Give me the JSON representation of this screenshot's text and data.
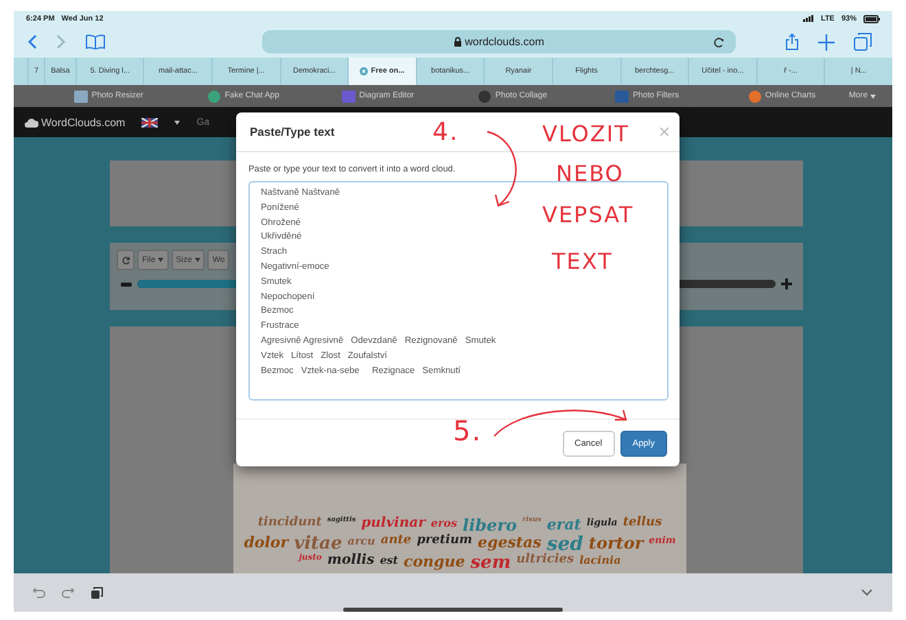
{
  "status_bar": {
    "time": "6:24 PM",
    "date": "Wed Jun 12",
    "network": "LTE",
    "battery": "93%"
  },
  "address_bar": {
    "url": "wordclouds.com"
  },
  "tabs": [
    {
      "label": "7",
      "selected": false
    },
    {
      "label": "Balsa",
      "selected": false
    },
    {
      "label": "5. Diving l...",
      "selected": false
    },
    {
      "label": "mail-attac...",
      "selected": false
    },
    {
      "label": "Termine |...",
      "selected": false
    },
    {
      "label": "Demokraci...",
      "selected": false
    },
    {
      "label": "Free on...",
      "selected": true
    },
    {
      "label": "botanikus...",
      "selected": false
    },
    {
      "label": "Ryanair",
      "selected": false
    },
    {
      "label": "Flights",
      "selected": false
    },
    {
      "label": "berchtesg...",
      "selected": false
    },
    {
      "label": "Učitel - ino...",
      "selected": false
    },
    {
      "label": "ř -...",
      "selected": false
    },
    {
      "label": "| N...",
      "selected": false
    }
  ],
  "bookmarks": [
    {
      "label": "Photo Resizer"
    },
    {
      "label": "Fake Chat App"
    },
    {
      "label": "Diagram Editor"
    },
    {
      "label": "Photo Collage"
    },
    {
      "label": "Photo Filters"
    },
    {
      "label": "Online Charts"
    }
  ],
  "bookmarks_more": "More",
  "site": {
    "logo": "WordClouds.com",
    "nav_item": "Ga"
  },
  "toolbar": [
    {
      "label": "File",
      "caret": true
    },
    {
      "label": "Size",
      "caret": true
    },
    {
      "label": "Wo",
      "caret": false
    }
  ],
  "slider": {
    "level": 0.75
  },
  "dialog": {
    "title": "Paste/Type text",
    "description": "Paste or type your text to convert it into a word cloud.",
    "text_value": "Naštvaně Naštvaně\nPonížené\nOhrožené\nUkřivděné\nStrach\nNegativní-emoce\nSmutek\nNepochopení\nBezmoc\nFrustrace\nAgresivně Agresivně   Odevzdaně   Rezignovaně   Smutek\nVztek   Lítost   Zlost   Zoufalství\nBezmoc   Vztek-na-sebe     Rezignace   Semknutí",
    "buttons": [
      {
        "label": "Cancel",
        "primary": false
      },
      {
        "label": "Apply",
        "primary": true
      }
    ]
  },
  "word_cloud": [
    {
      "text": "tincidunt",
      "color": "#8a5a3c"
    },
    {
      "text": "sagittis",
      "color": "#222222"
    },
    {
      "text": "pulvinar",
      "color": "#c0282d"
    },
    {
      "text": "eros",
      "color": "#c0282d"
    },
    {
      "text": "libero",
      "color": "#2e7d8a"
    },
    {
      "text": "risus",
      "color": "#8a5a3c"
    },
    {
      "text": "erat",
      "color": "#2e7d8a"
    },
    {
      "text": "ligula",
      "color": "#222222"
    },
    {
      "text": "tellus",
      "color": "#8f4d12"
    },
    {
      "text": "dolor",
      "color": "#8f4d12"
    },
    {
      "text": "vitae",
      "color": "#8a5a3c"
    },
    {
      "text": "arcu",
      "color": "#8a5a3c"
    },
    {
      "text": "ante",
      "color": "#8f4d12"
    },
    {
      "text": "pretium",
      "color": "#222222"
    },
    {
      "text": "egestas",
      "color": "#8f4d12"
    },
    {
      "text": "sed",
      "color": "#2e7d8a"
    },
    {
      "text": "tortor",
      "color": "#8f4d12"
    },
    {
      "text": "enim",
      "color": "#c0282d"
    },
    {
      "text": "justo",
      "color": "#c0282d"
    },
    {
      "text": "mollis",
      "color": "#222222"
    },
    {
      "text": "est",
      "color": "#222222"
    },
    {
      "text": "congue",
      "color": "#8f4d12"
    },
    {
      "text": "sem",
      "color": "#c0282d"
    },
    {
      "text": "ultricies",
      "color": "#8a5a3c"
    },
    {
      "text": "lacinia",
      "color": "#8f4d12"
    }
  ],
  "annotations": [
    {
      "text": "4."
    },
    {
      "text": "VLOZIT"
    },
    {
      "text": "NEBO"
    },
    {
      "text": "VEPSAT"
    },
    {
      "text": "TEXT"
    },
    {
      "text": "5."
    }
  ]
}
